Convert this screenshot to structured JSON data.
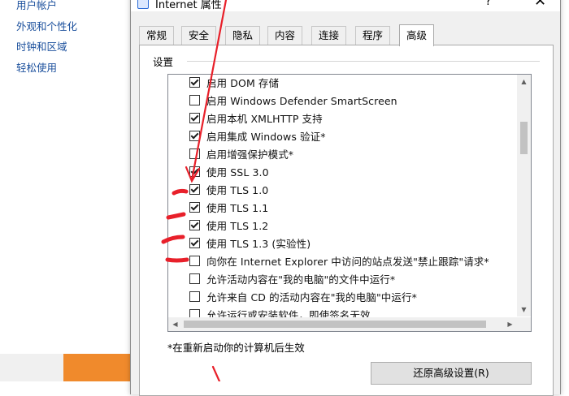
{
  "background": {
    "nav_items": [
      "用户帐户",
      "外观和个性化",
      "时钟和区域",
      "轻松使用"
    ]
  },
  "dialog": {
    "title": "Internet 属性",
    "help_glyph": "?",
    "close_glyph": "✕",
    "tabs": [
      "常规",
      "安全",
      "隐私",
      "内容",
      "连接",
      "程序",
      "高级"
    ],
    "active_tab": "高级",
    "section_label": "设置",
    "settings": [
      {
        "label": "启用 DOM 存储",
        "checked": true
      },
      {
        "label": "启用 Windows Defender SmartScreen",
        "checked": false
      },
      {
        "label": "启用本机 XMLHTTP 支持",
        "checked": true
      },
      {
        "label": "启用集成 Windows 验证*",
        "checked": true
      },
      {
        "label": "启用增强保护模式*",
        "checked": false
      },
      {
        "label": "使用 SSL 3.0",
        "checked": true
      },
      {
        "label": "使用 TLS 1.0",
        "checked": true
      },
      {
        "label": "使用 TLS 1.1",
        "checked": true
      },
      {
        "label": "使用 TLS 1.2",
        "checked": true
      },
      {
        "label": "使用 TLS 1.3 (实验性)",
        "checked": true
      },
      {
        "label": "向你在 Internet Explorer 中访问的站点发送\"禁止跟踪\"请求*",
        "checked": false
      },
      {
        "label": "允许活动内容在\"我的电脑\"的文件中运行*",
        "checked": false
      },
      {
        "label": "允许来自 CD 的活动内容在\"我的电脑\"中运行*",
        "checked": false
      },
      {
        "label": "允许运行或安装软件，即使签名无效",
        "checked": false
      }
    ],
    "restart_note": "*在重新启动你的计算机后生效",
    "restore_button": "还原高级设置(R)"
  },
  "colors": {
    "dialog_bg": "#f0f0f0",
    "annotation_red": "#e8202a",
    "orange_tile": "#f08a2c",
    "link_blue": "#1a4f9c"
  }
}
